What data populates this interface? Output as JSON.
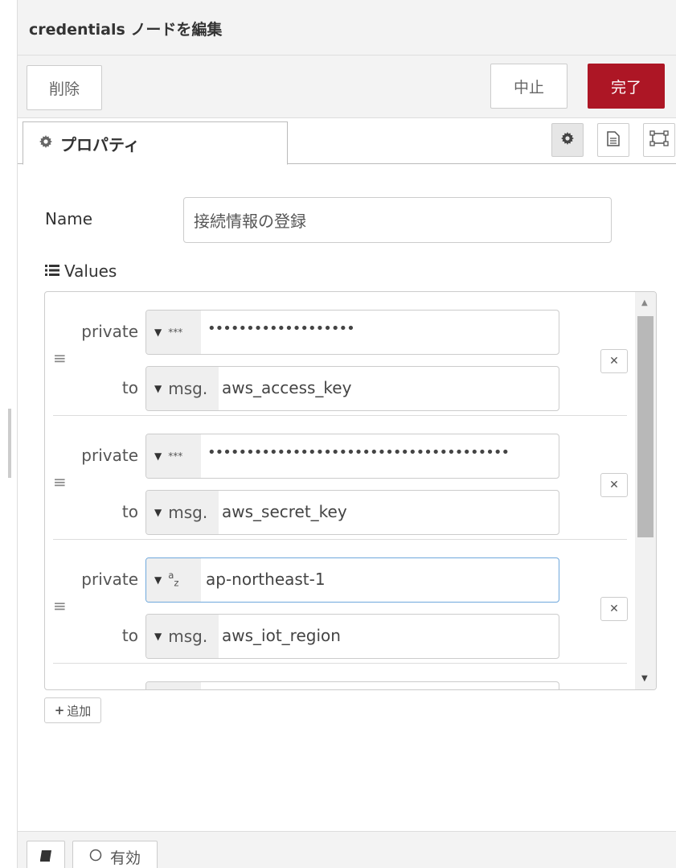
{
  "header": {
    "title": "credentials ノードを編集"
  },
  "toolbar": {
    "delete_label": "削除",
    "cancel_label": "中止",
    "done_label": "完了"
  },
  "tabs": {
    "properties_label": "プロパティ",
    "icons": [
      "gear-icon",
      "description-icon",
      "appearance-icon"
    ]
  },
  "form": {
    "name_label": "Name",
    "name_value": "接続情報の登録",
    "values_label": "Values"
  },
  "rows": [
    {
      "private_label": "private",
      "to_label": "to",
      "private_type": "***",
      "private_value": "•••••••••••••••••••",
      "to_type": "msg.",
      "to_value": "aws_access_key"
    },
    {
      "private_label": "private",
      "to_label": "to",
      "private_type": "***",
      "private_value": "•••••••••••••••••••••••••••••••••••••••",
      "to_type": "msg.",
      "to_value": "aws_secret_key"
    },
    {
      "private_label": "private",
      "to_label": "to",
      "private_type": "az",
      "private_type_a": "a",
      "private_type_z": "z",
      "private_value": "ap-northeast-1",
      "to_type": "msg.",
      "to_value": "aws_iot_region"
    }
  ],
  "add_label": "追加",
  "footer": {
    "enable_label": "有効"
  },
  "colors": {
    "done": "#ad1625",
    "focus_border": "#6fa8dc"
  }
}
